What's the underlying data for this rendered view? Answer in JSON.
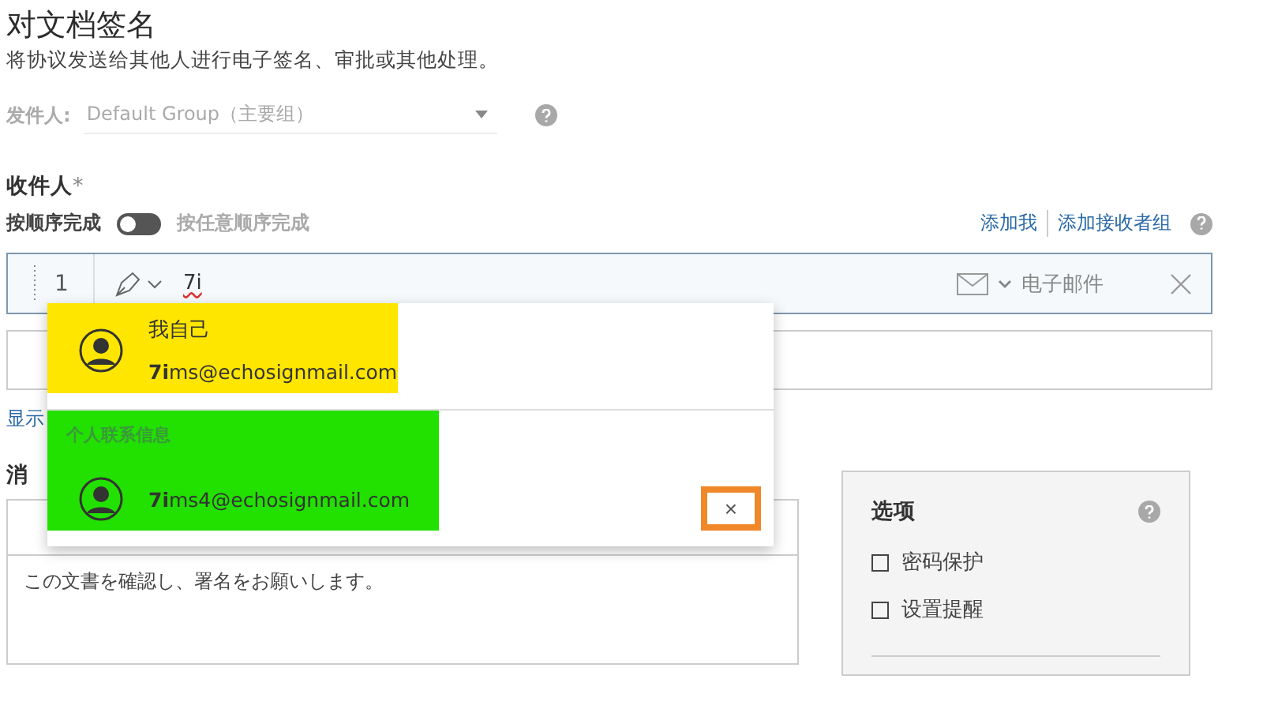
{
  "header": {
    "title": "对文档签名",
    "subtitle": "将协议发送给其他人进行电子签名、审批或其他处理。"
  },
  "sender": {
    "label": "发件人:",
    "value": "Default Group（主要组）",
    "disabled": true
  },
  "recipients": {
    "label": "收件人",
    "required_mark": "*",
    "order_label": "按顺序完成",
    "order_toggle_on": false,
    "any_order_label": "按任意顺序完成",
    "links": [
      "添加我",
      "添加接收者组"
    ],
    "rows": [
      {
        "number": "1",
        "value": "7i",
        "spell_error": true,
        "method": "电子邮件"
      }
    ]
  },
  "show_link": "显示",
  "message": {
    "label": "消",
    "body": "この文書を確認し、署名をお願いします。"
  },
  "options": {
    "title": "选项",
    "items": [
      {
        "label": "密码保护",
        "checked": false
      },
      {
        "label": "设置提醒",
        "checked": false
      }
    ]
  },
  "suggestions": [
    {
      "kind": "self",
      "color": "#ffe600",
      "name": "我自己",
      "email": "**7i**ms@echosignmail.com"
    },
    {
      "kind": "contact",
      "color": "#22e000",
      "section": "个人联系信息",
      "email": "**7i**ms4@echosignmail.com",
      "remove": {
        "text": "×",
        "outlined": true,
        "color": "#f0882a"
      }
    }
  ]
}
